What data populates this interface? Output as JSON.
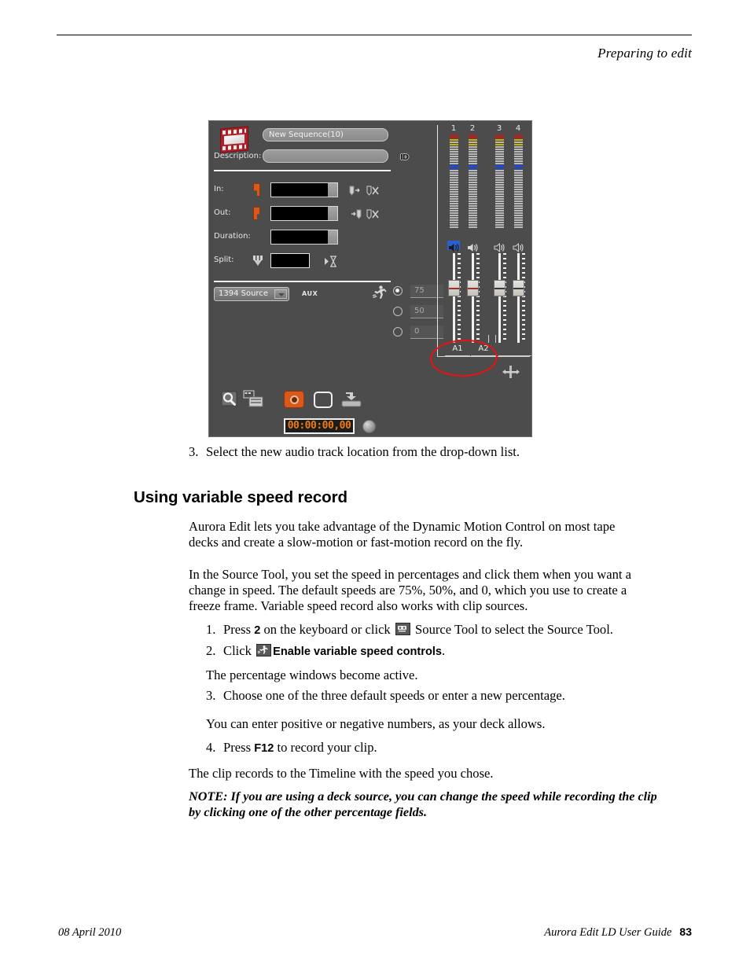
{
  "page": {
    "header_title": "Preparing to edit",
    "footer_date": "08 April 2010",
    "footer_guide": "Aurora Edit LD User Guide",
    "footer_pageno": "83"
  },
  "screenshot": {
    "title_field_value": "New Sequence(10)",
    "description_label": "Description:",
    "description_value": "",
    "id_badge": "ID",
    "rows": [
      {
        "label": "In:",
        "value": ""
      },
      {
        "label": "Out:",
        "value": ""
      },
      {
        "label": "Duration:",
        "value": ""
      },
      {
        "label": "Split:",
        "value": ""
      }
    ],
    "source_dropdown_value": "1394 Source",
    "aux_label": "AUX",
    "speed_options": [
      {
        "value": "75",
        "selected": true
      },
      {
        "value": "50",
        "selected": false
      },
      {
        "value": "0",
        "selected": false
      }
    ],
    "timecode_display": "00:00:00,00",
    "meter_numbers": [
      "1",
      "2",
      "3",
      "4"
    ],
    "track_boxes": [
      "A1",
      "A2",
      "",
      ""
    ],
    "colors": {
      "panel_bg": "#4c4c4c",
      "accent_orange": "#d9581a",
      "meter_red": "#b3201f",
      "meter_yellow": "#c9b200",
      "meter_blue": "#1a49d8",
      "annotation_red": "#ee1111",
      "timecode_orange": "#ef7a18"
    }
  },
  "body": {
    "step3_above": {
      "num": "3.",
      "text": "Select the new audio track location from the drop-down list."
    },
    "heading": "Using variable speed record",
    "para1": "Aurora Edit lets you take advantage of the Dynamic Motion Control on most tape decks and create a slow-motion or fast-motion record on the fly.",
    "para2": "In the Source Tool, you set the speed in percentages and click them when you want a change in speed. The default speeds are 75%, 50%, and 0, which you use to create a freeze frame. Variable speed record also works with clip sources.",
    "steps": [
      {
        "num": "1.",
        "pre": "Press ",
        "bold": "2",
        "mid": " on the keyboard or click ",
        "icon": "source-tool-icon",
        "post": " Source Tool to select the Source Tool."
      },
      {
        "num": "2.",
        "pre": "Click ",
        "icon": "variable-speed-icon",
        "bold": "Enable variable speed controls",
        "post": "."
      },
      {
        "num": "3.",
        "text": "Choose one of the three default speeds or enter a new percentage."
      },
      {
        "num": "4.",
        "pre": "Press ",
        "bold": "F12",
        "post": " to record your clip."
      }
    ],
    "sub1": "The percentage windows become active.",
    "sub2": "You can enter positive or negative numbers, as your deck allows.",
    "closing": "The clip records to the Timeline with the speed you chose.",
    "note": "NOTE:  If you are using a deck source, you can change the speed while recording the clip by clicking one of the other percentage fields."
  }
}
